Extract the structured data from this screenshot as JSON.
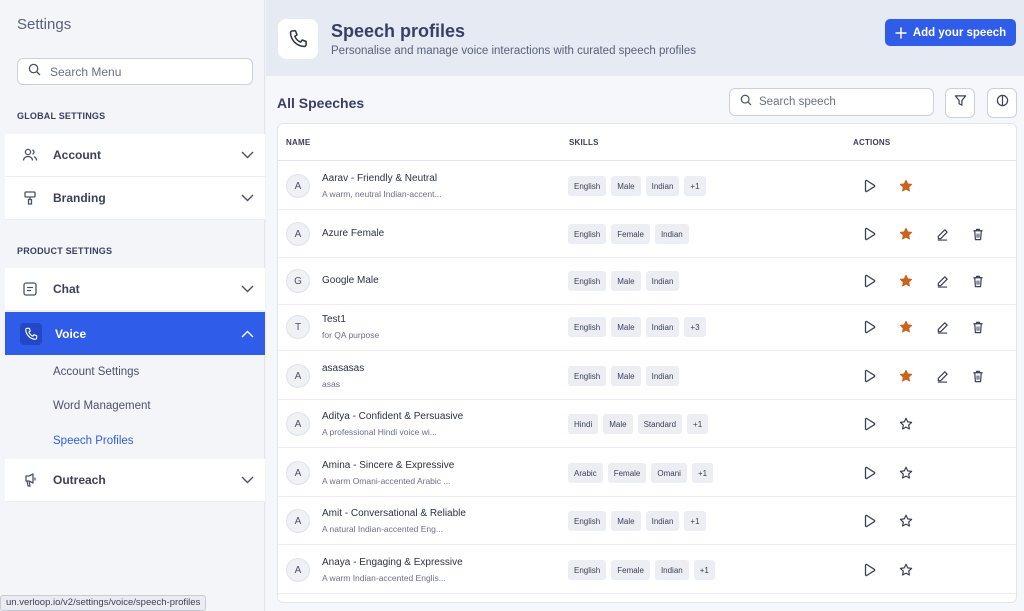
{
  "sidebar": {
    "title": "Settings",
    "search_placeholder": "Search Menu",
    "global_label": "GLOBAL SETTINGS",
    "product_label": "PRODUCT SETTINGS",
    "items": [
      {
        "label": "Account"
      },
      {
        "label": "Branding"
      },
      {
        "label": "Chat"
      },
      {
        "label": "Voice"
      },
      {
        "label": "Outreach"
      }
    ],
    "voice_sub": [
      "Account Settings",
      "Word Management",
      "Speech Profiles"
    ],
    "active_color": "#2f5ce8"
  },
  "status_url": "un.verloop.io/v2/settings/voice/speech-profiles",
  "header": {
    "title": "Speech profiles",
    "subtitle": "Personalise and manage voice interactions with curated speech profiles",
    "add_button": "Add your speech"
  },
  "main": {
    "title": "All Speeches",
    "search_placeholder": "Search speech",
    "columns": [
      "NAME",
      "SKILLS",
      "ACTIONS"
    ]
  },
  "rows": [
    {
      "initial": "A",
      "name": "Aarav - Friendly & Neutral",
      "desc": "A warm, neutral Indian-accent...",
      "skills": [
        "English",
        "Male",
        "Indian",
        "+1"
      ],
      "starred": true,
      "editable": false
    },
    {
      "initial": "A",
      "name": "Azure Female",
      "desc": "",
      "skills": [
        "English",
        "Female",
        "Indian"
      ],
      "starred": true,
      "editable": true
    },
    {
      "initial": "G",
      "name": "Google Male",
      "desc": "",
      "skills": [
        "English",
        "Male",
        "Indian"
      ],
      "starred": true,
      "editable": true
    },
    {
      "initial": "T",
      "name": "Test1",
      "desc": "for QA purpose",
      "skills": [
        "English",
        "Male",
        "Indian",
        "+3"
      ],
      "starred": true,
      "editable": true
    },
    {
      "initial": "A",
      "name": "asasasas",
      "desc": "asas",
      "skills": [
        "English",
        "Male",
        "Indian"
      ],
      "starred": true,
      "editable": true
    },
    {
      "initial": "A",
      "name": "Aditya - Confident & Persuasive",
      "desc": "A professional Hindi voice wi...",
      "skills": [
        "Hindi",
        "Male",
        "Standard",
        "+1"
      ],
      "starred": false,
      "editable": false
    },
    {
      "initial": "A",
      "name": "Amina - Sincere & Expressive",
      "desc": "A warm Omani-accented Arabic ...",
      "skills": [
        "Arabic",
        "Female",
        "Omani",
        "+1"
      ],
      "starred": false,
      "editable": false
    },
    {
      "initial": "A",
      "name": "Amit - Conversational & Reliable",
      "desc": "A natural Indian-accented Eng...",
      "skills": [
        "English",
        "Male",
        "Indian",
        "+1"
      ],
      "starred": false,
      "editable": false
    },
    {
      "initial": "A",
      "name": "Anaya - Engaging & Expressive",
      "desc": "A warm Indian-accented Englis...",
      "skills": [
        "English",
        "Female",
        "Indian",
        "+1"
      ],
      "starred": false,
      "editable": false
    }
  ],
  "star_color": "#c8641e"
}
